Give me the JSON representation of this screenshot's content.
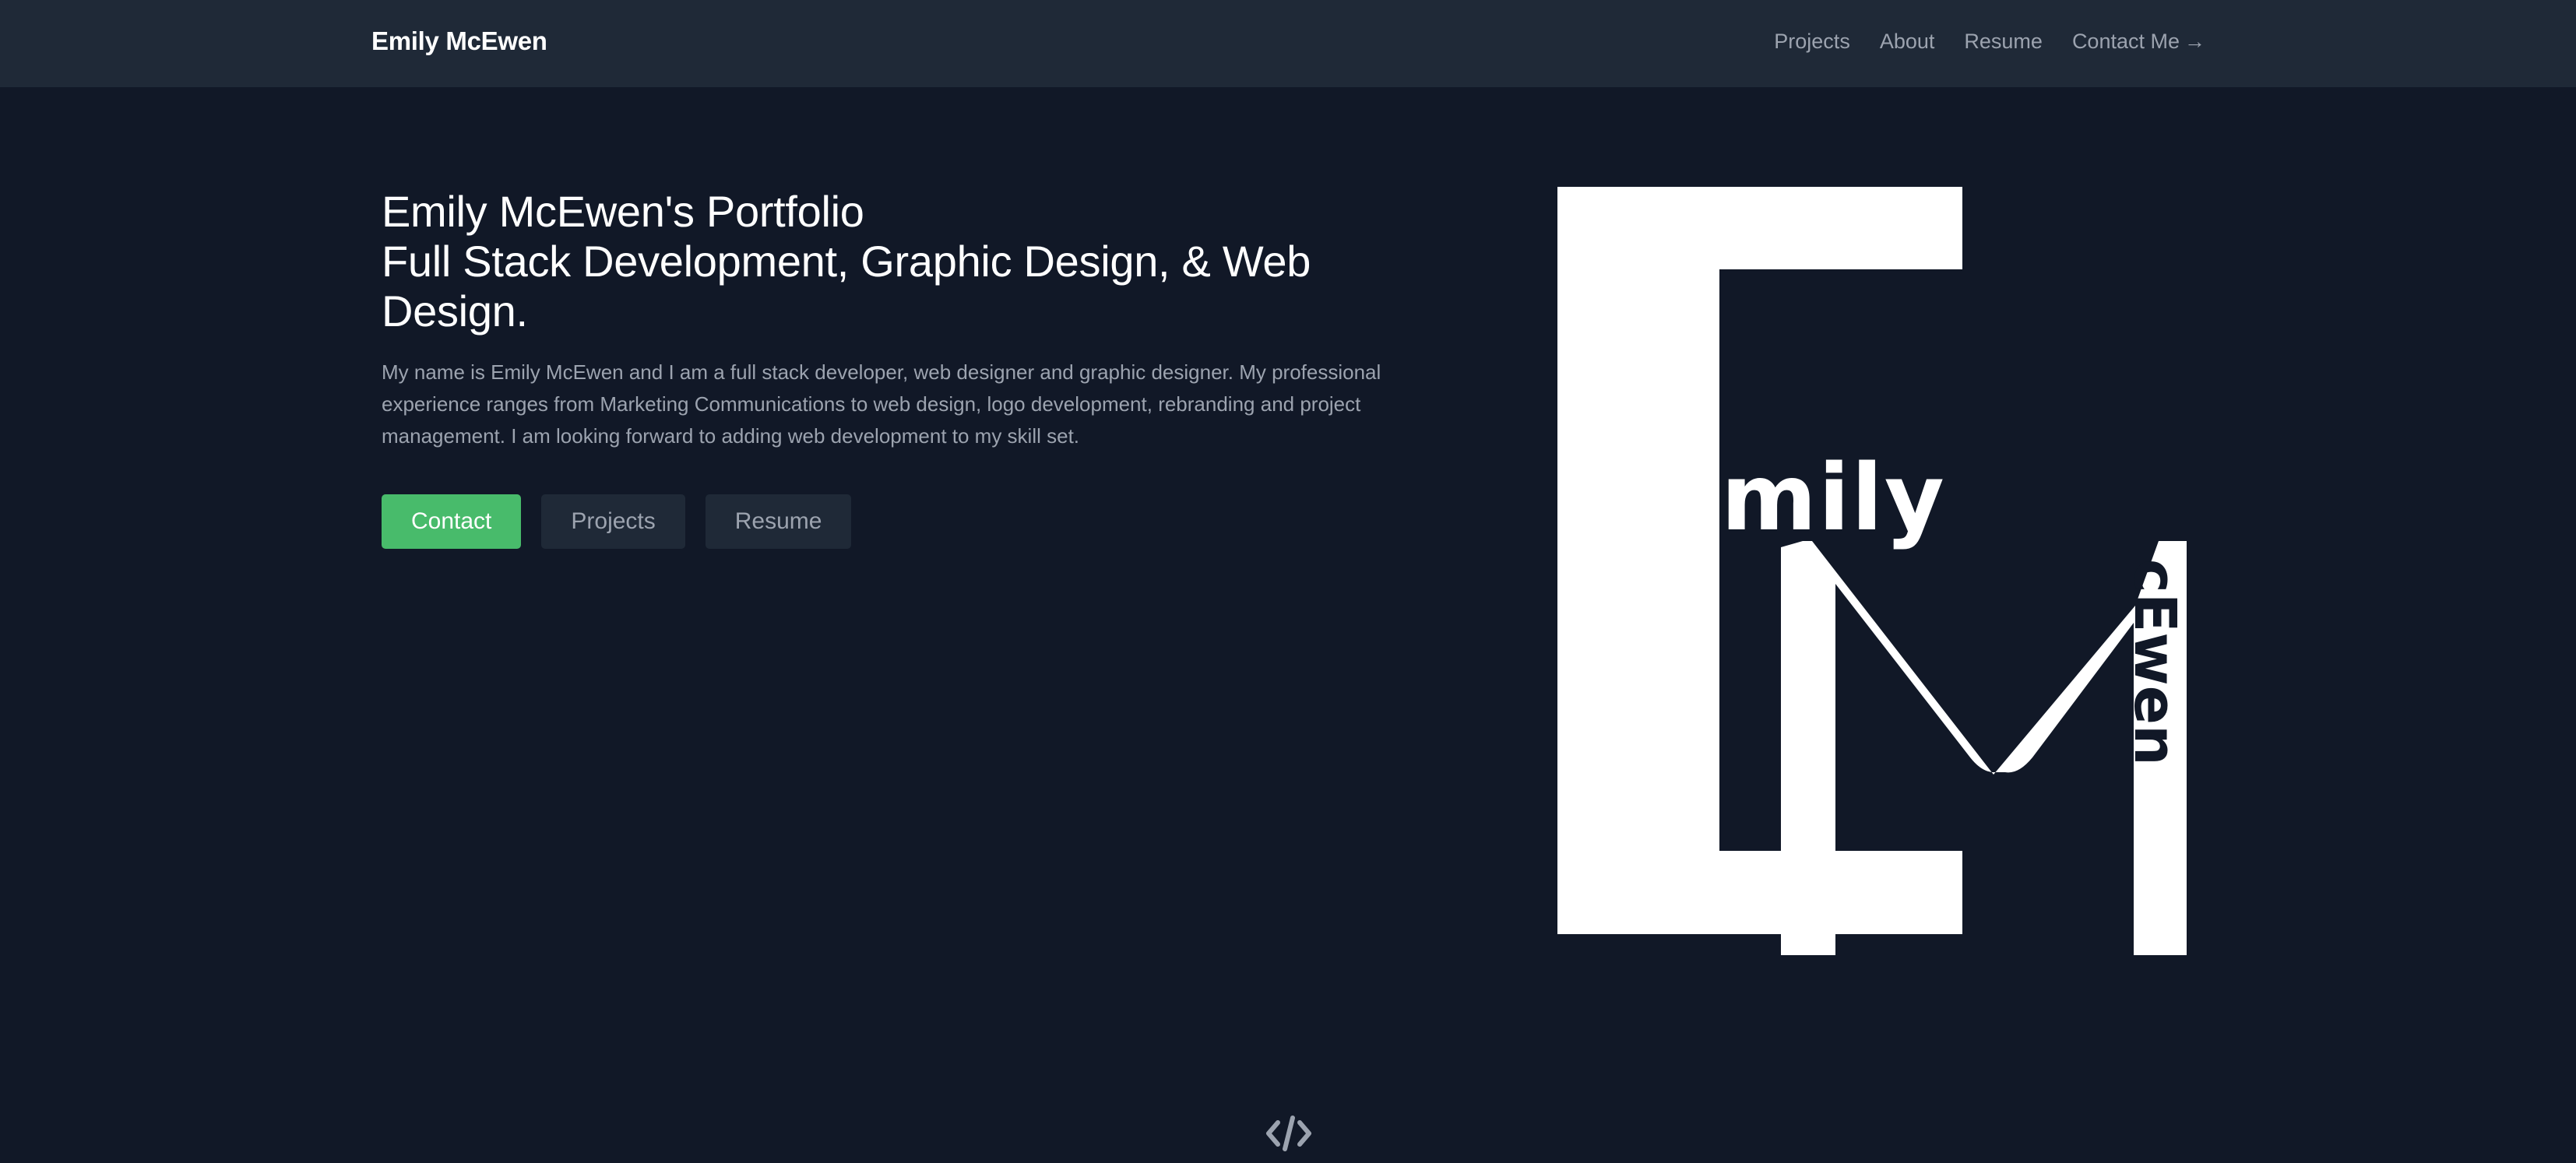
{
  "header": {
    "brand": "Emily McEwen",
    "nav": [
      {
        "label": "Projects"
      },
      {
        "label": "About"
      },
      {
        "label": "Resume"
      },
      {
        "label": "Contact Me",
        "icon": "arrow-right-icon"
      }
    ]
  },
  "hero": {
    "title_line1": "Emily McEwen's Portfolio",
    "title_line2": "Full Stack Development, Graphic Design, & Web Design.",
    "description": "My name is Emily McEwen and I am a full stack developer, web designer and graphic designer. My professional experience ranges from Marketing Communications to web design, logo development, rebranding and project management. I am looking forward to adding web development to my skill set.",
    "buttons": {
      "contact": "Contact",
      "projects": "Projects",
      "resume": "Resume"
    }
  },
  "logo": {
    "word_first": "mily",
    "word_last": "cEwen"
  },
  "footer": {
    "icon": "code-icon"
  },
  "colors": {
    "background": "#111827",
    "navbar": "#1f2937",
    "accent": "#48bb6b",
    "text_muted": "#9ca3af",
    "text_primary": "#ffffff"
  }
}
